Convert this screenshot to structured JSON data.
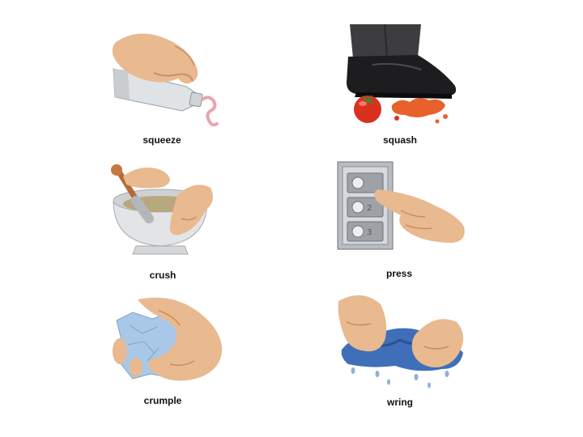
{
  "items": [
    {
      "label": "squeeze",
      "icon": "toothpaste-tube-squeeze-icon"
    },
    {
      "label": "squash",
      "icon": "shoe-squashing-tomato-icon"
    },
    {
      "label": "crush",
      "icon": "mortar-and-pestle-icon"
    },
    {
      "label": "press",
      "icon": "finger-pressing-button-icon"
    },
    {
      "label": "crumple",
      "icon": "hand-crumpling-paper-icon"
    },
    {
      "label": "wring",
      "icon": "hands-wringing-cloth-icon"
    }
  ],
  "colors": {
    "skin": "#e9b98f",
    "skin_shadow": "#c98d62",
    "tomato": "#d8321f",
    "cloth_blue": "#3f6fb8",
    "metal": "#b9bcc0"
  }
}
